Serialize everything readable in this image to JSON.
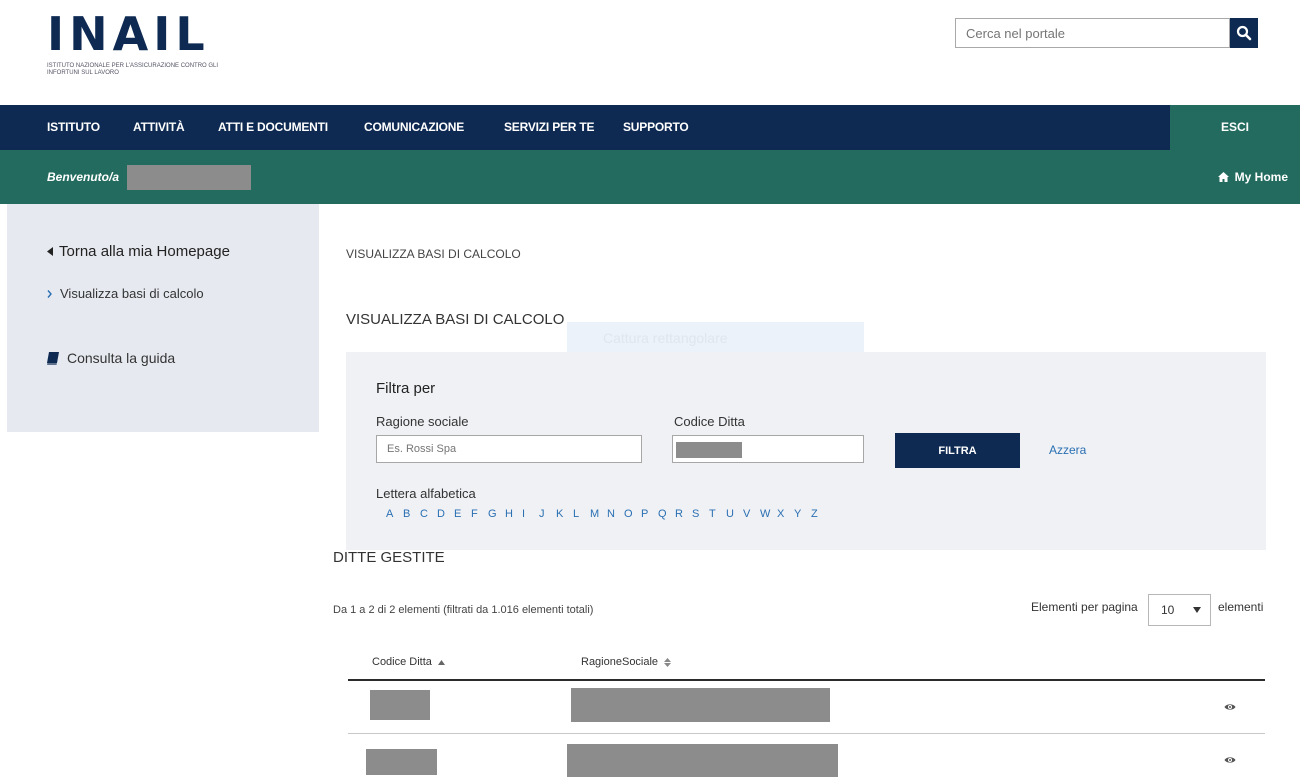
{
  "header": {
    "logo_text": "INAIL",
    "logo_subtitle": "ISTITUTO NAZIONALE PER L'ASSICURAZIONE CONTRO GLI INFORTUNI SUL LAVORO",
    "search_placeholder": "Cerca nel portale",
    "search_icon": "search-icon"
  },
  "nav": {
    "items": [
      "ISTITUTO",
      "ATTIVITÀ",
      "ATTI E DOCUMENTI",
      "COMUNICAZIONE",
      "SERVIZI PER TE",
      "SUPPORTO"
    ],
    "logout": "ESCI"
  },
  "welcome": {
    "label": "Benvenuto/a",
    "home_link": "My Home",
    "home_icon": "home-icon"
  },
  "sidebar": {
    "back": "Torna alla mia Homepage",
    "current": "Visualizza basi di calcolo",
    "guide": "Consulta la guida"
  },
  "content": {
    "breadcrumb": "VISUALIZZA BASI DI CALCOLO",
    "title": "VISUALIZZA BASI DI CALCOLO",
    "overlay_text": "Cattura rettangolare"
  },
  "filter": {
    "title": "Filtra per",
    "ragione_label": "Ragione sociale",
    "ragione_placeholder": "Es. Rossi Spa",
    "codice_label": "Codice Ditta",
    "button": "FILTRA",
    "reset": "Azzera",
    "letters_label": "Lettera alfabetica",
    "letters": [
      "A",
      "B",
      "C",
      "D",
      "E",
      "F",
      "G",
      "H",
      "I",
      "J",
      "K",
      "L",
      "M",
      "N",
      "O",
      "P",
      "Q",
      "R",
      "S",
      "T",
      "U",
      "V",
      "W",
      "X",
      "Y",
      "Z"
    ]
  },
  "results": {
    "section_title": "DITTE GESTITE",
    "count_text": "Da 1 a 2 di 2 elementi (filtrati da 1.016 elementi totali)",
    "per_page_label": "Elementi per pagina",
    "per_page_value": "10",
    "per_page_suffix": "elementi",
    "columns": [
      "Codice Ditta",
      "RagioneSociale"
    ],
    "row_icon": "eye-icon"
  },
  "colors": {
    "navy": "#0e2a52",
    "teal": "#236b5e",
    "link": "#2a6fb2",
    "panel": "#eff1f5",
    "sidebar": "#e6eaf0"
  }
}
